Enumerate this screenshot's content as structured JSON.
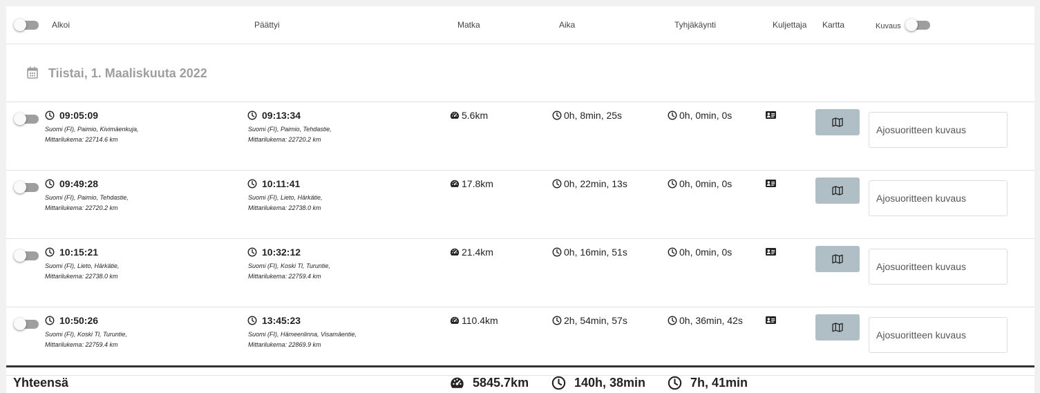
{
  "header": {
    "columns": {
      "started": "Alkoi",
      "ended": "Päättyi",
      "distance": "Matka",
      "duration": "Aika",
      "idle": "Tyhjäkäynti",
      "driver": "Kuljettaja",
      "map": "Kartta",
      "description": "Kuvaus"
    }
  },
  "date_group": {
    "title": "Tiistai, 1. Maaliskuuta 2022"
  },
  "trips": [
    {
      "start_time": "09:05:09",
      "start_location": "Suomi (FI), Paimio, Kivimäenkuja,",
      "start_odometer": "Mittarilukema: 22714.6 km",
      "end_time": "09:13:34",
      "end_location": "Suomi (FI), Paimio, Tehdastie,",
      "end_odometer": "Mittarilukema: 22720.2 km",
      "distance": "5.6km",
      "duration": "0h, 8min, 25s",
      "idle": "0h, 0min, 0s",
      "description_placeholder": "Ajosuoritteen kuvaus"
    },
    {
      "start_time": "09:49:28",
      "start_location": "Suomi (FI), Paimio, Tehdastie,",
      "start_odometer": "Mittarilukema: 22720.2 km",
      "end_time": "10:11:41",
      "end_location": "Suomi (FI), Lieto, Härkätie,",
      "end_odometer": "Mittarilukema: 22738.0 km",
      "distance": "17.8km",
      "duration": "0h, 22min, 13s",
      "idle": "0h, 0min, 0s",
      "description_placeholder": "Ajosuoritteen kuvaus"
    },
    {
      "start_time": "10:15:21",
      "start_location": "Suomi (FI), Lieto, Härkätie,",
      "start_odometer": "Mittarilukema: 22738.0 km",
      "end_time": "10:32:12",
      "end_location": "Suomi (FI), Koski Tl, Turuntie,",
      "end_odometer": "Mittarilukema: 22759.4 km",
      "distance": "21.4km",
      "duration": "0h, 16min, 51s",
      "idle": "0h, 0min, 0s",
      "description_placeholder": "Ajosuoritteen kuvaus"
    },
    {
      "start_time": "10:50:26",
      "start_location": "Suomi (FI), Koski Tl, Turuntie,",
      "start_odometer": "Mittarilukema: 22759.4 km",
      "end_time": "13:45:23",
      "end_location": "Suomi (FI), Hämeenlinna, Visamäentie,",
      "end_odometer": "Mittarilukema: 22869.9 km",
      "distance": "110.4km",
      "duration": "2h, 54min, 57s",
      "idle": "0h, 36min, 42s",
      "description_placeholder": "Ajosuoritteen kuvaus"
    }
  ],
  "totals": {
    "label": "Yhteensä",
    "distance": "5845.7km",
    "duration": "140h, 38min",
    "idle": "7h, 41min"
  },
  "icons": {
    "clock": "clock-icon",
    "speedometer": "speedometer-icon",
    "driver": "id-card-icon",
    "map": "map-icon",
    "calendar": "calendar-icon"
  },
  "colors": {
    "map_button": "#b0bec5",
    "toggle_track": "#9e9e9e",
    "date_title": "#9e9e9e"
  }
}
